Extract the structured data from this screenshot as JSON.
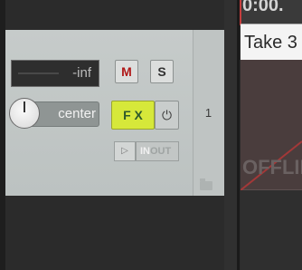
{
  "track": {
    "volume_display": "-inf",
    "mute_label": "M",
    "solo_label": "S",
    "pan_label": "center",
    "fx_label": "F X",
    "fx_power_icon": "⏻",
    "route_icon": "▷",
    "inout_in": "IN",
    "inout_out": "OUT",
    "number": "1"
  },
  "arrange": {
    "timecode": "0:00.",
    "item_name": "Take 3",
    "item_status": "OFFLINE"
  },
  "colors": {
    "fx_active": "#d6e83a",
    "mute_red": "#b01818",
    "item_body": "#4a3d3d"
  }
}
